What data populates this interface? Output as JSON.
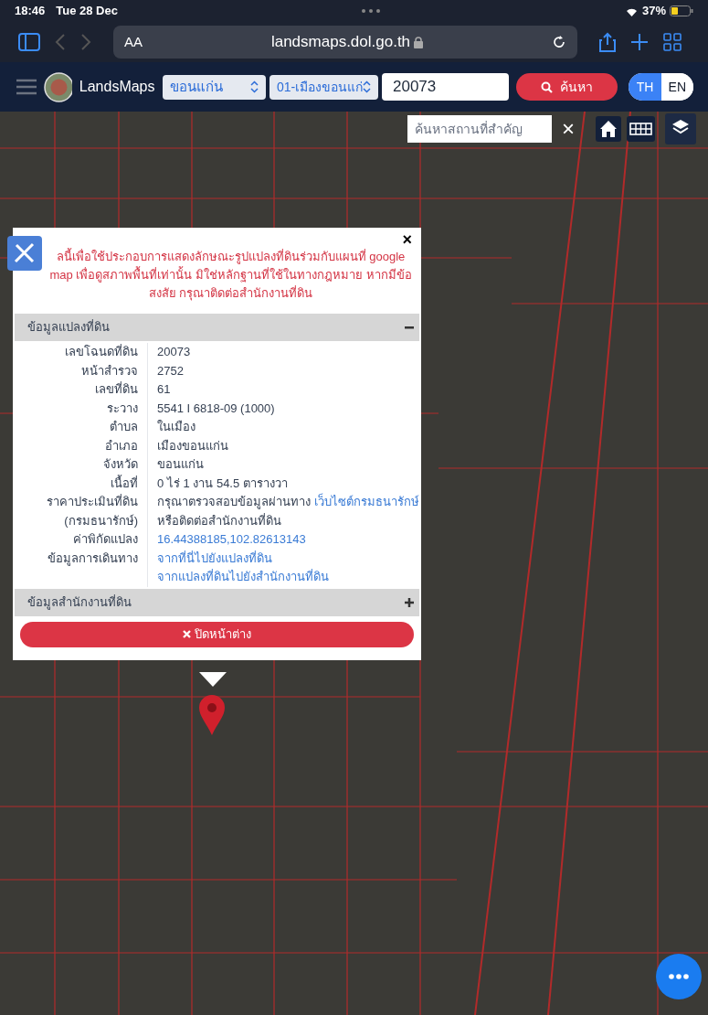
{
  "status_bar": {
    "time": "18:46",
    "date": "Tue 28 Dec",
    "battery": "37%"
  },
  "browser": {
    "text_size": "AA",
    "url": "landsmaps.dol.go.th"
  },
  "app_header": {
    "logo_text": "LandsMaps",
    "province": "ขอนแก่น",
    "district": "01-เมืองขอนแก่",
    "parcel_number": "20073",
    "search_button": "ค้นหา",
    "languages": [
      {
        "label": "TH",
        "selected": true
      },
      {
        "label": "EN",
        "selected": false
      }
    ]
  },
  "map": {
    "place_search": {
      "placeholder": "ค้นหาสถานที่สำคัญ"
    },
    "close": "×"
  },
  "popup": {
    "close": "×",
    "notice": "ลนี้เพื่อใช้ประกอบการแสดงลักษณะรูปแปลงที่ดินร่วมกับแผนที่ google map เพื่อดูสภาพพื้นที่เท่านั้น มิใช่หลักฐานที่ใช้ในทางกฎหมาย หากมีข้อสงสัย กรุณาติดต่อสำนักงานที่ดิน",
    "sections": [
      {
        "title": "ข้อมูลแปลงที่ดิน",
        "expanded": true,
        "rows": [
          {
            "label": "เลขโฉนดที่ดิน",
            "values": [
              {
                "text": "20073"
              }
            ]
          },
          {
            "label": "หน้าสำรวจ",
            "values": [
              {
                "text": "2752"
              }
            ]
          },
          {
            "label": "เลขที่ดิน",
            "values": [
              {
                "text": "61"
              }
            ]
          },
          {
            "label": "ระวาง",
            "values": [
              {
                "text": "5541 I 6818-09 (1000)"
              }
            ]
          },
          {
            "label": "ตำบล",
            "values": [
              {
                "text": "ในเมือง"
              }
            ]
          },
          {
            "label": "อำเภอ",
            "values": [
              {
                "text": "เมืองขอนแก่น"
              }
            ]
          },
          {
            "label": "จังหวัด",
            "values": [
              {
                "text": "ขอนแก่น"
              }
            ]
          },
          {
            "label": "เนื้อที่",
            "values": [
              {
                "text": "0 ไร่ 1 งาน 54.5 ตารางวา"
              }
            ]
          },
          {
            "label": "ราคาประเมินที่ดิน",
            "values": [
              {
                "text": "กรุณาตรวจสอบข้อมูลผ่านทาง",
                "link": "เว็บไซต์กรมธนารักษ์"
              }
            ]
          },
          {
            "label": "(กรมธนารักษ์)",
            "values": [
              {
                "text": "หรือติดต่อสำนักงานที่ดิน"
              }
            ]
          },
          {
            "label": "ค่าพิกัดแปลง",
            "values": [
              {
                "link": "16.44388185,102.82613143"
              }
            ]
          },
          {
            "label": "ข้อมูลการเดินทาง",
            "values": [
              {
                "link": "จากที่นี่ไปยังแปลงที่ดิน"
              },
              {
                "link": "จากแปลงที่ดินไปยังสำนักงานที่ดิน"
              }
            ]
          }
        ]
      },
      {
        "title": "ข้อมูลสำนักงานที่ดิน",
        "expanded": false
      }
    ],
    "close_button": "ปิดหน้าต่าง"
  }
}
